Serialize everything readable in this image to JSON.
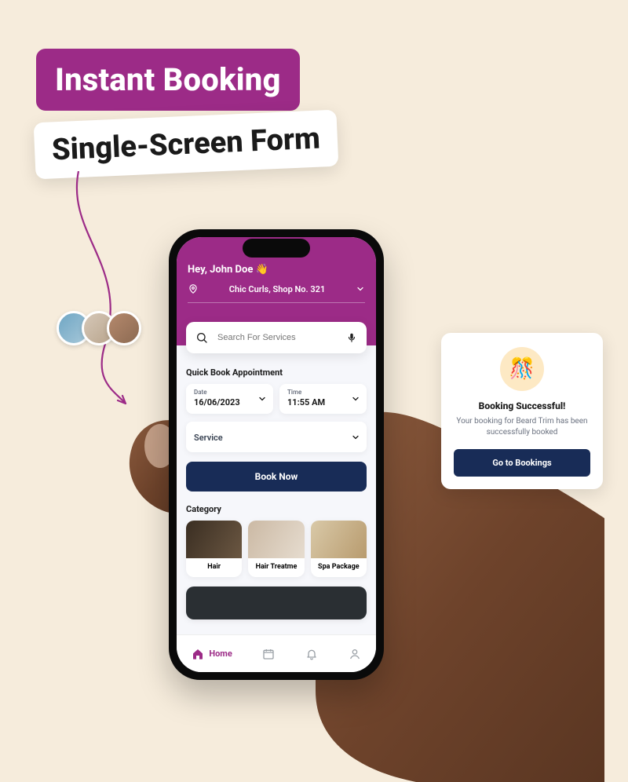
{
  "headline": {
    "line1": "Instant Booking",
    "line2": "Single-Screen Form"
  },
  "colors": {
    "magenta": "#9c2b87",
    "navy": "#182c57",
    "cream": "#f6ecdc"
  },
  "app": {
    "greeting": "Hey, John Doe 👋",
    "location": "Chic Curls, Shop No. 321",
    "search_placeholder": "Search For Services",
    "quick_book_title": "Quick Book Appointment",
    "fields": {
      "date_label": "Date",
      "date_value": "16/06/2023",
      "time_label": "Time",
      "time_value": "11:55 AM",
      "service_label": "Service"
    },
    "book_button": "Book Now",
    "category_title": "Category",
    "categories": [
      {
        "label": "Hair"
      },
      {
        "label": "Hair Treatme"
      },
      {
        "label": "Spa Package"
      }
    ],
    "nav": {
      "home": "Home"
    }
  },
  "toast": {
    "title": "Booking Successful!",
    "body": "Your booking for Beard Trim has been successfully booked",
    "button": "Go to Bookings"
  }
}
